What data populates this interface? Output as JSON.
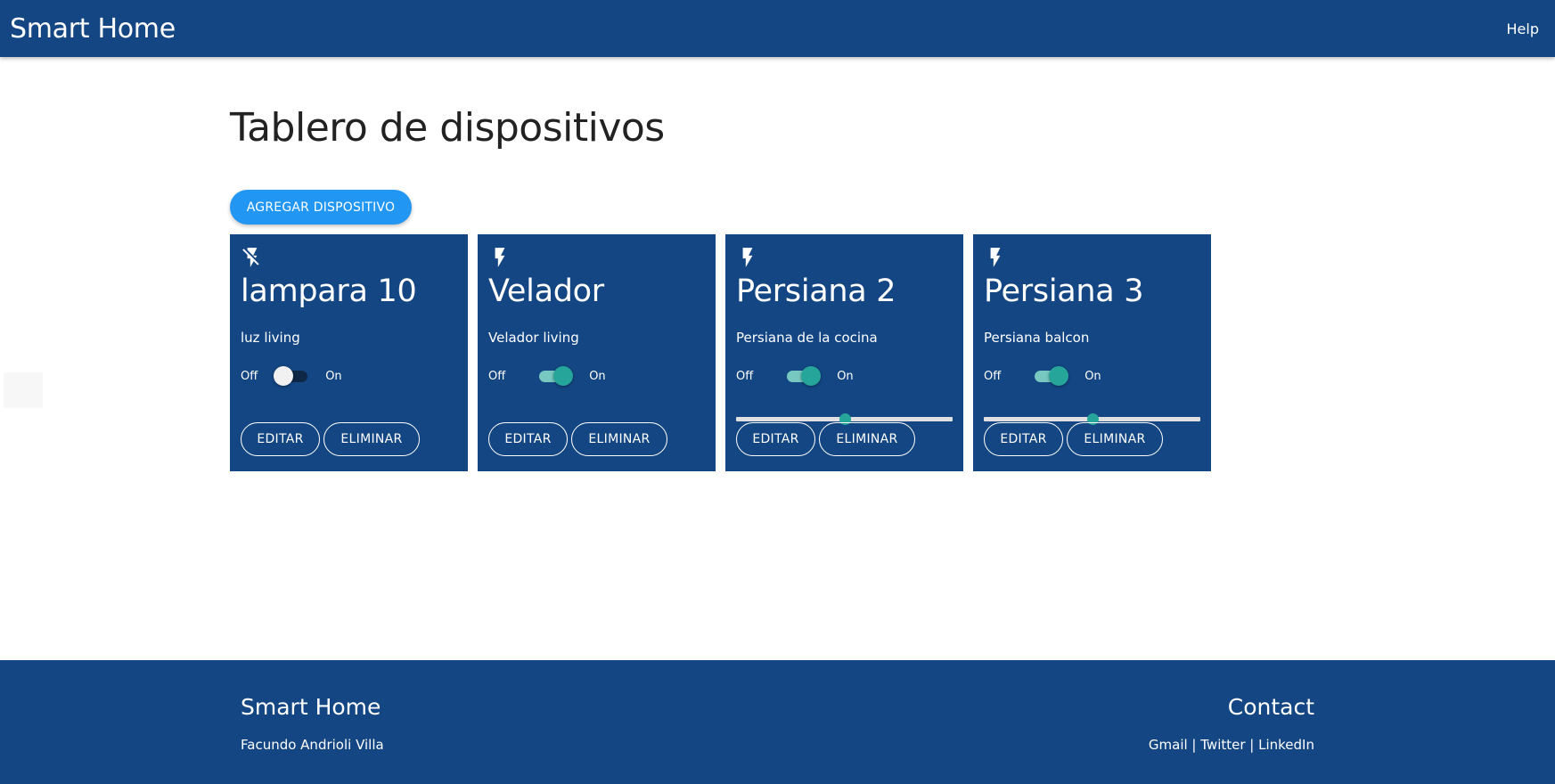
{
  "navbar": {
    "brand": "Smart Home",
    "help": "Help"
  },
  "main": {
    "title": "Tablero de dispositivos",
    "add_button": "AGREGAR DISPOSITIVO"
  },
  "devices": [
    {
      "name": "lampara 10",
      "description": "luz living",
      "icon": "flash-off-icon",
      "state": false,
      "has_slider": false,
      "slider_value": null,
      "off_label": "Off",
      "on_label": "On",
      "edit_label": "EDITAR",
      "delete_label": "ELIMINAR"
    },
    {
      "name": "Velador",
      "description": "Velador living",
      "icon": "flash-icon",
      "state": true,
      "has_slider": false,
      "slider_value": null,
      "off_label": "Off",
      "on_label": "On",
      "edit_label": "EDITAR",
      "delete_label": "ELIMINAR"
    },
    {
      "name": "Persiana 2",
      "description": "Persiana de la cocina",
      "icon": "flash-icon",
      "state": true,
      "has_slider": true,
      "slider_value": 0.5,
      "off_label": "Off",
      "on_label": "On",
      "edit_label": "EDITAR",
      "delete_label": "ELIMINAR"
    },
    {
      "name": "Persiana 3",
      "description": "Persiana balcon",
      "icon": "flash-icon",
      "state": true,
      "has_slider": true,
      "slider_value": 0.5,
      "off_label": "Off",
      "on_label": "On",
      "edit_label": "EDITAR",
      "delete_label": "ELIMINAR"
    }
  ],
  "footer": {
    "left_title": "Smart Home",
    "author": "Facundo Andrioli Villa",
    "right_title": "Contact",
    "links": [
      "Gmail",
      "Twitter",
      "LinkedIn"
    ],
    "separator": " | "
  },
  "colors": {
    "primary": "#134683",
    "accent": "#2196f3",
    "switch_on": "#26a69a"
  }
}
